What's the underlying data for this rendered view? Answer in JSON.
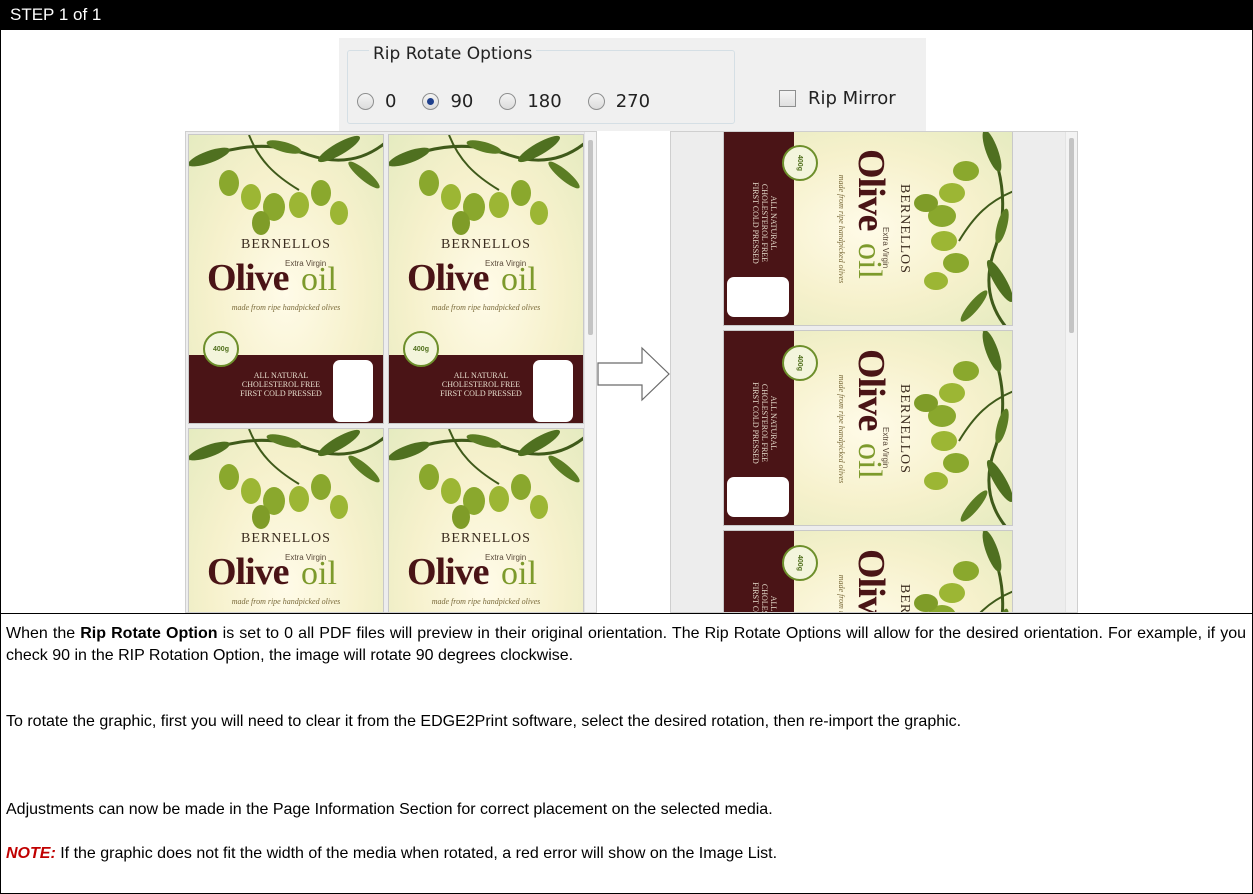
{
  "header": {
    "title": "STEP 1 of 1"
  },
  "options": {
    "group_label": "Rip Rotate Options",
    "radios": [
      {
        "label": "0",
        "selected": false
      },
      {
        "label": "90",
        "selected": true
      },
      {
        "label": "180",
        "selected": false
      },
      {
        "label": "270",
        "selected": false
      }
    ],
    "mirror_label": "Rip Mirror",
    "mirror_checked": false
  },
  "label_art": {
    "brand": "BERNELLOS",
    "extra": "Extra Virgin",
    "olive": "Olive",
    "oil": "oil",
    "tagline": "made from ripe handpicked olives",
    "band_lines": [
      "ALL NATURAL",
      "CHOLESTEROL FREE",
      "FIRST COLD PRESSED"
    ],
    "badge": "400g"
  },
  "instructions": {
    "p1_pre": "When the ",
    "p1_bold": "Rip Rotate Option",
    "p1_post": " is set to 0 all PDF files will preview in their original orientation. The Rip Rotate Options will allow for the desired orientation. For example, if you check 90 in the RIP Rotation Option, the image will rotate 90 degrees clockwise.",
    "p2": "To rotate the graphic, first you will need to clear it from the EDGE2Print software, select the desired rotation, then re-import the graphic.",
    "p3": "Adjustments can now be made in the Page Information Section for correct placement on the selected media.",
    "note_key": "NOTE:",
    "note_text": " If the graphic does not fit the width of the media when rotated, a red error will show on the Image List."
  },
  "colors": {
    "accent_red": "#c00000",
    "radio_selected": "#1e3f8c",
    "label_band": "#4a1416",
    "oil_green": "#7d9a2c"
  }
}
